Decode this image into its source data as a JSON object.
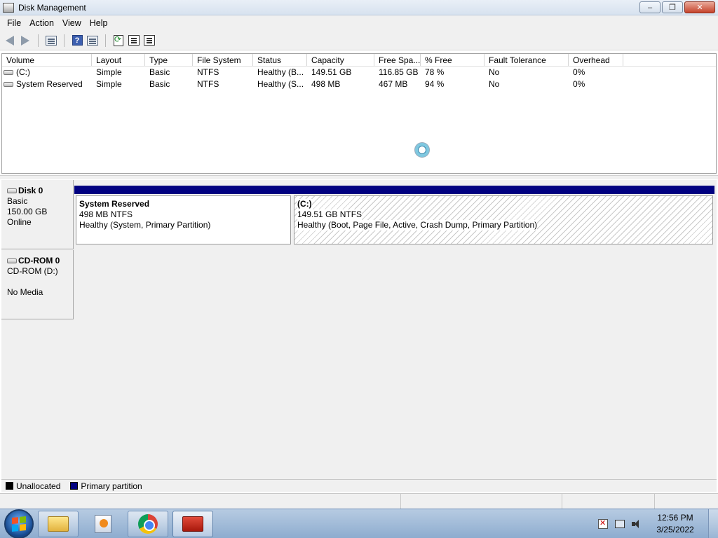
{
  "window": {
    "title": "Disk Management",
    "controls": {
      "minimize": "–",
      "maximize": "❐",
      "close": "✕"
    }
  },
  "menu": [
    "File",
    "Action",
    "View",
    "Help"
  ],
  "toolbar": {
    "icons": [
      "back-icon",
      "forward-icon",
      "show-hide-console-tree-icon",
      "help-icon",
      "console-pane-icon",
      "refresh-icon",
      "properties-icon",
      "help-topics-icon"
    ]
  },
  "volume_list": {
    "columns": [
      "Volume",
      "Layout",
      "Type",
      "File System",
      "Status",
      "Capacity",
      "Free Spa...",
      "% Free",
      "Fault Tolerance",
      "Overhead"
    ],
    "rows": [
      {
        "volume": "(C:)",
        "layout": "Simple",
        "type": "Basic",
        "fs": "NTFS",
        "status": "Healthy (B...",
        "capacity": "149.51 GB",
        "free": "116.85 GB",
        "pct_free": "78 %",
        "fault": "No",
        "overhead": "0%"
      },
      {
        "volume": "System Reserved",
        "layout": "Simple",
        "type": "Basic",
        "fs": "NTFS",
        "status": "Healthy (S...",
        "capacity": "498 MB",
        "free": "467 MB",
        "pct_free": "94 %",
        "fault": "No",
        "overhead": "0%"
      }
    ]
  },
  "disks": [
    {
      "name": "Disk 0",
      "line1": "Basic",
      "line2": "150.00 GB",
      "line3": "Online",
      "partitions": [
        {
          "name": "System Reserved",
          "size": "498 MB NTFS",
          "status": "Healthy (System, Primary Partition)"
        },
        {
          "name": "(C:)",
          "size": "149.51 GB NTFS",
          "status": "Healthy (Boot, Page File, Active, Crash Dump, Primary Partition)"
        }
      ]
    },
    {
      "name": "CD-ROM 0",
      "line1": "CD-ROM (D:)",
      "line2": "",
      "line3": "No Media"
    }
  ],
  "legend": [
    {
      "label": "Unallocated",
      "color": "#000000"
    },
    {
      "label": "Primary partition",
      "color": "#000080"
    }
  ],
  "taskbar": {
    "apps": [
      "windows-explorer",
      "media-player",
      "chrome",
      "toolbox"
    ],
    "time": "12:56 PM",
    "date": "3/25/2022"
  }
}
